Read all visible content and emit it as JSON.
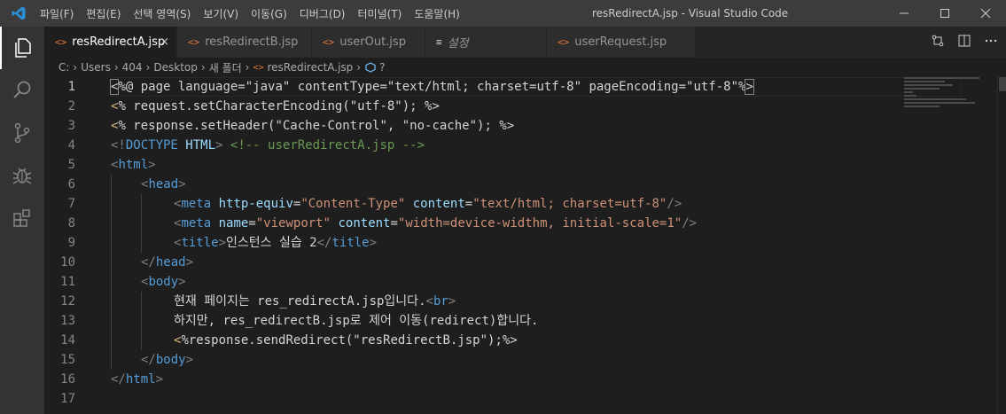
{
  "titlebar": {
    "menu": [
      "파일(F)",
      "편집(E)",
      "선택 영역(S)",
      "보기(V)",
      "이동(G)",
      "디버그(D)",
      "터미널(T)",
      "도움말(H)"
    ],
    "title": "resRedirectA.jsp - Visual Studio Code"
  },
  "tabs": [
    {
      "label": "resRedirectA.jsp",
      "icon": "<>",
      "active": true,
      "close": "×"
    },
    {
      "label": "resRedirectB.jsp",
      "icon": "<>",
      "active": false
    },
    {
      "label": "userOut.jsp",
      "icon": "<>",
      "active": false
    },
    {
      "label": "설정",
      "icon": "≡",
      "active": false
    },
    {
      "label": "userRequest.jsp",
      "icon": "<>",
      "active": false
    }
  ],
  "breadcrumb": {
    "parts": [
      "C:",
      "Users",
      "404",
      "Desktop",
      "새 폴더",
      "resRedirectA.jsp",
      "?"
    ]
  },
  "editor": {
    "line_numbers": [
      "1",
      "2",
      "3",
      "4",
      "5",
      "6",
      "7",
      "8",
      "9",
      "10",
      "11",
      "12",
      "13",
      "14",
      "15",
      "16",
      "17"
    ]
  },
  "code": {
    "l1": [
      "<",
      "%@ page language=\"java\" contentType=\"text/html; charset=utf-8\" pageEncoding=\"utf-8\"%",
      ">"
    ],
    "l2": [
      "<",
      "% request.setCharacterEncoding(\"utf-8\"); %>"
    ],
    "l3": [
      "<",
      "% response.setHeader(\"Cache-Control\", \"no-cache\"); %>"
    ],
    "l4": [
      "<!",
      "DOCTYPE",
      " HTML",
      ">",
      " <!-- userRedirectA.jsp -->"
    ],
    "l5": [
      "<",
      "html",
      ">"
    ],
    "l6": [
      "<",
      "head",
      ">"
    ],
    "l7": [
      "<",
      "meta",
      " http-equiv",
      "=",
      "\"Content-Type\"",
      " content",
      "=",
      "\"text/html; charset=utf-8\"",
      "/>"
    ],
    "l8": [
      "<",
      "meta",
      " name",
      "=",
      "\"viewport\"",
      " content",
      "=",
      "\"width=device-widthm, initial-scale=1\"",
      "/>"
    ],
    "l9": [
      "<",
      "title",
      ">",
      "인스턴스 실습 2",
      "</",
      "title",
      ">"
    ],
    "l10": [
      "</",
      "head",
      ">"
    ],
    "l11": [
      "<",
      "body",
      ">"
    ],
    "l12": [
      "현재 페이지는 res_redirectA.jsp입니다.",
      "<",
      "br",
      ">"
    ],
    "l13": [
      "하지만, res_redirectB.jsp로 제어 이동(redirect)합니다."
    ],
    "l14": [
      "<",
      "%response.sendRedirect(\"resRedirectB.jsp\");%>"
    ],
    "l15": [
      "</",
      "body",
      ">"
    ],
    "l16": [
      "</",
      "html",
      ">"
    ]
  },
  "colors": {
    "background": "#1e1e1e",
    "titlebar": "#3c3c3c",
    "activitybar": "#333333",
    "tag": "#569cd6",
    "attr": "#9cdcfe",
    "string": "#ce9178",
    "comment": "#6a9955",
    "bracket": "#808080"
  },
  "icons": {
    "activity": [
      "files-icon",
      "search-icon",
      "source-control-icon",
      "debug-icon",
      "extensions-icon"
    ],
    "tab_actions": [
      "open-changes-icon",
      "split-editor-icon",
      "more-actions-icon"
    ]
  }
}
